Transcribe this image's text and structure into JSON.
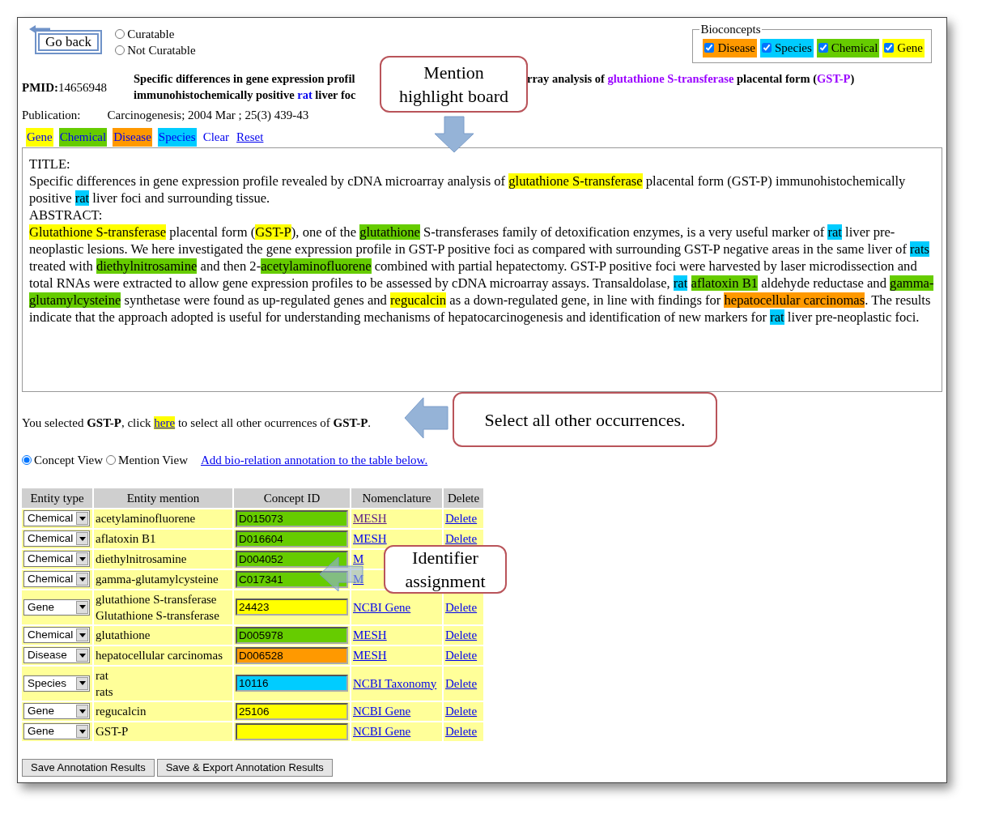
{
  "go_back": "Go back",
  "curation": [
    {
      "label": "Curatable",
      "selected": false
    },
    {
      "label": "Not Curatable",
      "selected": false
    }
  ],
  "bioconcepts": {
    "legend": "Bioconcepts",
    "items": [
      {
        "label": "Disease",
        "kind": "disease",
        "checked": true,
        "color": "#ff9900"
      },
      {
        "label": "Species",
        "kind": "species",
        "checked": true,
        "color": "#00ccff"
      },
      {
        "label": "Chemical",
        "kind": "chemical",
        "checked": true,
        "color": "#66cc00"
      },
      {
        "label": "Gene",
        "kind": "gene",
        "checked": true,
        "color": "#ffff00"
      }
    ]
  },
  "pmid": {
    "label": "PMID:",
    "value": "14656948"
  },
  "title": {
    "left_lines": [
      [
        {
          "text": "Specific differences in gene expression profil",
          "kind": "plain"
        }
      ],
      [
        {
          "text": "immunohistochemically positive ",
          "kind": "plain"
        },
        {
          "text": "rat",
          "kind": "species"
        },
        {
          "text": " liver foc",
          "kind": "plain"
        }
      ]
    ],
    "right": [
      {
        "text": "rray analysis of ",
        "kind": "plain"
      },
      {
        "text": "glutathione S-transferase",
        "kind": "gene"
      },
      {
        "text": " placental form (",
        "kind": "plain"
      },
      {
        "text": "GST-P",
        "kind": "gene"
      },
      {
        "text": ")",
        "kind": "plain"
      }
    ],
    "callout": {
      "text": "Mention highlight board"
    }
  },
  "publication": {
    "label": "Publication:",
    "value": "Carcinogenesis; 2004 Mar ; 25(3) 439-43"
  },
  "highlight_buttons": [
    {
      "label": "Gene",
      "kind": "gene"
    },
    {
      "label": "Chemical",
      "kind": "chemical"
    },
    {
      "label": "Disease",
      "kind": "disease"
    },
    {
      "label": "Species",
      "kind": "species"
    },
    {
      "label": "Clear",
      "kind": "action"
    },
    {
      "label": "Reset",
      "kind": "link"
    }
  ],
  "document": {
    "title_label": "TITLE:",
    "title": [
      {
        "text": "Specific differences in gene expression profile revealed by cDNA microarray analysis of ",
        "kind": "plain"
      },
      {
        "text": "glutathione S-transferase",
        "kind": "gene"
      },
      {
        "text": " placental form (GST-P) immunohistochemically positive ",
        "kind": "plain"
      },
      {
        "text": "rat",
        "kind": "species"
      },
      {
        "text": " liver foci and surrounding tissue.",
        "kind": "plain"
      }
    ],
    "abstract_label": "ABSTRACT:",
    "abstract": [
      {
        "text": "Glutathione S-transferase",
        "kind": "gene"
      },
      {
        "text": " placental form (",
        "kind": "plain"
      },
      {
        "text": "GST-P",
        "kind": "gene"
      },
      {
        "text": "), one of the ",
        "kind": "plain"
      },
      {
        "text": "glutathione",
        "kind": "chemical"
      },
      {
        "text": " S-transferases family of detoxification enzymes, is a very useful marker of ",
        "kind": "plain"
      },
      {
        "text": "rat",
        "kind": "species"
      },
      {
        "text": " liver pre-neoplastic lesions. We here investigated the gene expression profile in GST-P positive foci as compared with surrounding GST-P negative areas in the same liver of ",
        "kind": "plain"
      },
      {
        "text": "rats",
        "kind": "species"
      },
      {
        "text": " treated with ",
        "kind": "plain"
      },
      {
        "text": "diethylnitrosamine",
        "kind": "chemical"
      },
      {
        "text": " and then 2-",
        "kind": "plain"
      },
      {
        "text": "acetylaminofluorene",
        "kind": "chemical"
      },
      {
        "text": " combined with partial hepatectomy. GST-P positive foci were harvested by laser microdissection and total RNAs were extracted to allow gene expression profiles to be assessed by cDNA microarray assays. Transaldolase, ",
        "kind": "plain"
      },
      {
        "text": "rat",
        "kind": "species"
      },
      {
        "text": "aflatoxin B1",
        "kind": "chemical"
      },
      {
        "text": " aldehyde reductase and ",
        "kind": "plain"
      },
      {
        "text": "gamma-glutamylcysteine",
        "kind": "chemical"
      },
      {
        "text": " synthetase were found as up-regulated genes and ",
        "kind": "plain"
      },
      {
        "text": "regucalcin",
        "kind": "gene"
      },
      {
        "text": " as a down-regulated gene, in line with findings for ",
        "kind": "plain"
      },
      {
        "text": "hepatocellular carcinomas",
        "kind": "disease"
      },
      {
        "text": ". The results indicate that the approach adopted is useful for understanding mechanisms of hepatocarcinogenesis and identification of new markers for ",
        "kind": "plain"
      },
      {
        "text": "rat",
        "kind": "species"
      },
      {
        "text": " liver pre-neoplastic foci.",
        "kind": "plain"
      }
    ]
  },
  "selection": {
    "before": "You selected **GST-P**, click ",
    "link": "here",
    "after": " to select all other ocurrences of **GST-P**.",
    "callout": {
      "text": "Select all other occurrences."
    }
  },
  "views": [
    {
      "label": "Concept View",
      "selected": true
    },
    {
      "label": "Mention View",
      "selected": false
    }
  ],
  "add_relation_link": "Add bio-relation annotation to the table below.",
  "table": {
    "columns": [
      "Entity type",
      "Entity mention",
      "Concept ID",
      "Nomenclature",
      "Delete"
    ],
    "rows": [
      {
        "entity_type": "Chemical",
        "mentions": [
          "acetylaminofluorene"
        ],
        "concept_id": "D015073",
        "color": "#66cc00",
        "nomenclature": "MESH",
        "visited": true,
        "delete": "Delete"
      },
      {
        "entity_type": "Chemical",
        "mentions": [
          "aflatoxin B1"
        ],
        "concept_id": "D016604",
        "color": "#66cc00",
        "nomenclature": "MESH",
        "visited": false,
        "delete": "Delete"
      },
      {
        "entity_type": "Chemical",
        "mentions": [
          "diethylnitrosamine"
        ],
        "concept_id": "D004052",
        "color": "#66cc00",
        "nomenclature": "M",
        "visited": false
      },
      {
        "entity_type": "Chemical",
        "mentions": [
          "gamma-glutamylcysteine"
        ],
        "concept_id": "C017341",
        "color": "#66cc00",
        "nomenclature": "M",
        "visited": false
      },
      {
        "entity_type": "Gene",
        "mentions": [
          "glutathione S-transferase",
          "Glutathione S-transferase"
        ],
        "concept_id": "24423",
        "color": "#ffff00",
        "nomenclature": "NCBI Gene",
        "visited": false,
        "delete": "Delete"
      },
      {
        "entity_type": "Chemical",
        "mentions": [
          "glutathione"
        ],
        "concept_id": "D005978",
        "color": "#66cc00",
        "nomenclature": "MESH",
        "visited": false,
        "delete": "Delete"
      },
      {
        "entity_type": "Disease",
        "mentions": [
          "hepatocellular carcinomas"
        ],
        "concept_id": "D006528",
        "color": "#ff9900",
        "nomenclature": "MESH",
        "visited": false,
        "delete": "Delete"
      },
      {
        "entity_type": "Species",
        "mentions": [
          "rat",
          "rats"
        ],
        "concept_id": "10116",
        "color": "#00ccff",
        "nomenclature": "NCBI Taxonomy",
        "visited": false,
        "delete": "Delete"
      },
      {
        "entity_type": "Gene",
        "mentions": [
          "regucalcin"
        ],
        "concept_id": "25106",
        "color": "#ffff00",
        "nomenclature": "NCBI Gene",
        "visited": false,
        "delete": "Delete"
      },
      {
        "entity_type": "Gene",
        "mentions": [
          "GST-P"
        ],
        "color": "#ffff00",
        "nomenclature": "NCBI Gene",
        "visited": false,
        "delete": "Delete"
      }
    ],
    "callout": {
      "text": "Identifier assignment"
    }
  },
  "buttons": [
    "Save Annotation Results",
    "Save & Export Annotation Results"
  ]
}
